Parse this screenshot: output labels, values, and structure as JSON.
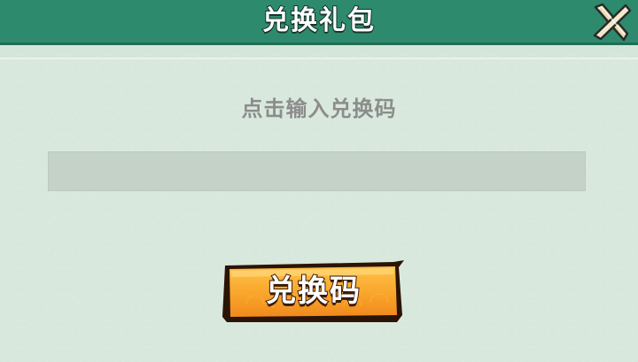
{
  "dialog": {
    "title": "兑换礼包",
    "close_icon": "close-x-icon"
  },
  "form": {
    "prompt": "点击输入兑换码",
    "code_value": "",
    "code_placeholder": ""
  },
  "actions": {
    "redeem_label": "兑换码"
  },
  "colors": {
    "header_bg": "#2e8a6d",
    "body_bg": "#d4e5d9",
    "input_bg": "#c5d2c8",
    "button_orange": "#f7a22c",
    "button_border": "#2b1405",
    "title_text": "#ffffff",
    "prompt_text": "#8c8c8c"
  }
}
